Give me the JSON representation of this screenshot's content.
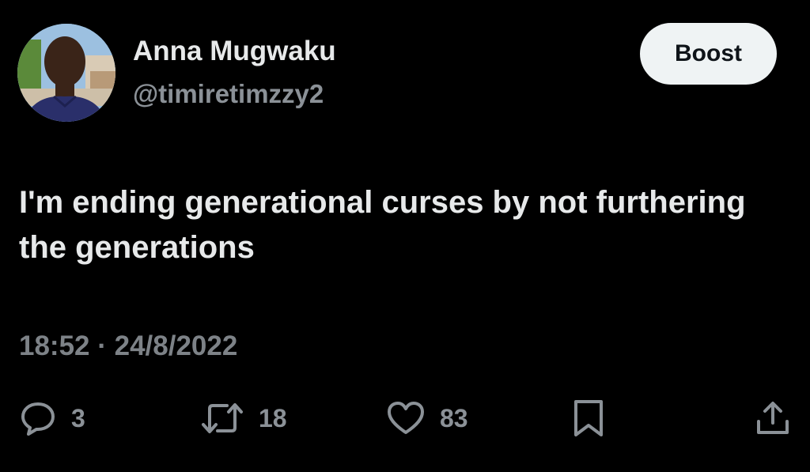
{
  "author": {
    "display_name": "Anna Mugwaku",
    "handle": "@timiretimzzy2"
  },
  "header": {
    "boost_label": "Boost"
  },
  "tweet": {
    "text": "I'm ending generational curses by not furthering the generations",
    "timestamp": "18:52 · 24/8/2022"
  },
  "actions": {
    "replies": "3",
    "retweets": "18",
    "likes": "83",
    "reply_icon": "reply-bubble-icon",
    "retweet_icon": "retweet-icon",
    "like_icon": "heart-icon",
    "bookmark_icon": "bookmark-icon",
    "share_icon": "share-icon"
  },
  "colors": {
    "background": "#000000",
    "primary_text": "#e7e9ea",
    "secondary_text": "#8b9197",
    "button_bg": "#eff3f4"
  }
}
